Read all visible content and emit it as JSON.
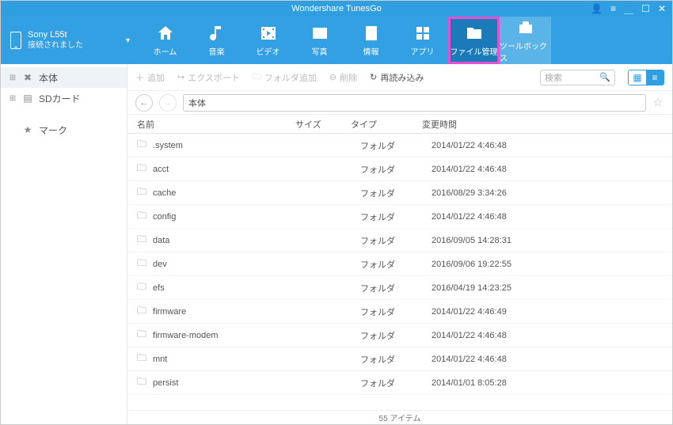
{
  "app": {
    "title": "Wondershare TunesGo"
  },
  "device": {
    "name": "Sony L55t",
    "status": "接続されました"
  },
  "nav": {
    "items": [
      {
        "key": "home",
        "label": "ホーム"
      },
      {
        "key": "music",
        "label": "音楽"
      },
      {
        "key": "video",
        "label": "ビデオ"
      },
      {
        "key": "photo",
        "label": "写真"
      },
      {
        "key": "info",
        "label": "情報"
      },
      {
        "key": "apps",
        "label": "アプリ"
      },
      {
        "key": "files",
        "label": "ファイル管理"
      },
      {
        "key": "toolbox",
        "label": "ツールボックス"
      }
    ]
  },
  "sidebar": {
    "internal": "本体",
    "sdcard": "SDカード",
    "bookmarks": "マーク"
  },
  "toolbar": {
    "add": "追加",
    "export": "エクスポート",
    "newfolder": "フォルダ追加",
    "delete": "削除",
    "reload": "再読み込み",
    "search_placeholder": "検索"
  },
  "path": {
    "current": "本体"
  },
  "columns": {
    "name": "名前",
    "size": "サイズ",
    "type": "タイプ",
    "time": "変更時間"
  },
  "type_folder": "フォルダ",
  "files": [
    {
      "name": ".system",
      "size": "",
      "type": "フォルダ",
      "time": "2014/01/22 4:46:48"
    },
    {
      "name": "acct",
      "size": "",
      "type": "フォルダ",
      "time": "2014/01/22 4:46:48"
    },
    {
      "name": "cache",
      "size": "",
      "type": "フォルダ",
      "time": "2016/08/29 3:34:26"
    },
    {
      "name": "config",
      "size": "",
      "type": "フォルダ",
      "time": "2014/01/22 4:46:48"
    },
    {
      "name": "data",
      "size": "",
      "type": "フォルダ",
      "time": "2016/09/05 14:28:31"
    },
    {
      "name": "dev",
      "size": "",
      "type": "フォルダ",
      "time": "2016/09/06 19:22:55"
    },
    {
      "name": "efs",
      "size": "",
      "type": "フォルダ",
      "time": "2016/04/19 14:23:25"
    },
    {
      "name": "firmware",
      "size": "",
      "type": "フォルダ",
      "time": "2014/01/22 4:46:49"
    },
    {
      "name": "firmware-modem",
      "size": "",
      "type": "フォルダ",
      "time": "2014/01/22 4:46:48"
    },
    {
      "name": "mnt",
      "size": "",
      "type": "フォルダ",
      "time": "2014/01/22 4:46:48"
    },
    {
      "name": "persist",
      "size": "",
      "type": "フォルダ",
      "time": "2014/01/01 8:05:28"
    }
  ],
  "status": {
    "count_text": "55 アイテム"
  }
}
